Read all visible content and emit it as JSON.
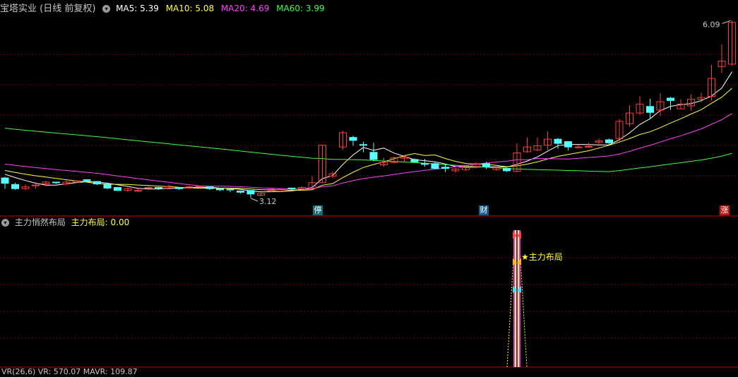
{
  "main_panel": {
    "title": "宝塔实业 (日线 前复权)",
    "indicators": [
      {
        "label": "MA5: 5.39",
        "color": "#ffffff"
      },
      {
        "label": "MA10: 5.08",
        "color": "#ffff40"
      },
      {
        "label": "MA20: 4.69",
        "color": "#ff40ff"
      },
      {
        "label": "MA60: 3.99",
        "color": "#40ff40"
      }
    ],
    "high_label": "6.09",
    "low_label": "3.12",
    "event_markers": [
      "停",
      "财",
      "涨"
    ]
  },
  "sub_panel": {
    "title": "主力悄然布局",
    "value_label": "主力布局: 0.00",
    "signal_label": "主力布局"
  },
  "bottom_strip": {
    "label": "VR(26,6)  VR: 570.07  MAVR: 109.87"
  },
  "colors": {
    "up": "#ff3c3c",
    "down": "#54ffff",
    "grid": "#7a0000",
    "divider": "#c80000",
    "ma5": "#ffffff",
    "ma10": "#ffff40",
    "ma20": "#ff40ff",
    "ma60": "#40ff40"
  },
  "chart_data": {
    "type": "candlestick",
    "ohlc": [
      [
        3.45,
        3.36,
        3.47,
        3.27
      ],
      [
        3.34,
        3.27,
        3.37,
        3.25
      ],
      [
        3.27,
        3.3,
        3.34,
        3.25
      ],
      [
        3.33,
        3.33,
        3.35,
        3.27
      ],
      [
        3.35,
        3.38,
        3.4,
        3.31
      ],
      [
        3.38,
        3.37,
        3.38,
        3.35
      ],
      [
        3.35,
        3.38,
        3.42,
        3.33
      ],
      [
        3.38,
        3.4,
        3.41,
        3.37
      ],
      [
        3.42,
        3.4,
        3.43,
        3.38
      ],
      [
        3.39,
        3.35,
        3.4,
        3.33
      ],
      [
        3.34,
        3.28,
        3.37,
        3.26
      ],
      [
        3.29,
        3.24,
        3.3,
        3.23
      ],
      [
        3.24,
        3.27,
        3.29,
        3.22
      ],
      [
        3.23,
        3.24,
        3.27,
        3.21
      ],
      [
        3.29,
        3.29,
        3.32,
        3.27
      ],
      [
        3.29,
        3.28,
        3.3,
        3.25
      ],
      [
        3.27,
        3.31,
        3.34,
        3.26
      ],
      [
        3.29,
        3.27,
        3.29,
        3.25
      ],
      [
        3.28,
        3.3,
        3.32,
        3.27
      ],
      [
        3.3,
        3.31,
        3.32,
        3.29
      ],
      [
        3.3,
        3.27,
        3.3,
        3.25
      ],
      [
        3.27,
        3.25,
        3.28,
        3.23
      ],
      [
        3.26,
        3.25,
        3.26,
        3.21
      ],
      [
        3.23,
        3.21,
        3.24,
        3.19
      ],
      [
        3.24,
        3.18,
        3.24,
        3.12
      ],
      [
        3.16,
        3.19,
        3.2,
        3.14
      ],
      [
        3.23,
        3.26,
        3.27,
        3.21
      ],
      [
        3.26,
        3.26,
        3.28,
        3.24
      ],
      [
        3.28,
        3.27,
        3.28,
        3.25
      ],
      [
        3.27,
        3.29,
        3.31,
        3.24
      ],
      [
        3.28,
        3.37,
        3.48,
        3.28
      ],
      [
        3.37,
        4.0,
        4.0,
        3.37
      ],
      [
        3.48,
        3.52,
        3.56,
        3.45
      ],
      [
        3.97,
        4.21,
        4.24,
        3.92
      ],
      [
        4.13,
        4.08,
        4.16,
        3.99
      ],
      [
        4.01,
        4.0,
        4.06,
        3.88
      ],
      [
        3.88,
        3.76,
        4.04,
        3.73
      ],
      [
        3.67,
        3.71,
        3.79,
        3.64
      ],
      [
        3.71,
        3.79,
        3.81,
        3.69
      ],
      [
        3.78,
        3.8,
        3.83,
        3.71
      ],
      [
        3.76,
        3.72,
        3.78,
        3.71
      ],
      [
        3.69,
        3.68,
        3.77,
        3.64
      ],
      [
        3.69,
        3.61,
        3.72,
        3.6
      ],
      [
        3.63,
        3.61,
        3.67,
        3.55
      ],
      [
        3.57,
        3.6,
        3.62,
        3.54
      ],
      [
        3.59,
        3.64,
        3.67,
        3.57
      ],
      [
        3.64,
        3.69,
        3.71,
        3.61
      ],
      [
        3.69,
        3.64,
        3.72,
        3.6
      ],
      [
        3.59,
        3.62,
        3.64,
        3.57
      ],
      [
        3.61,
        3.57,
        3.62,
        3.55
      ],
      [
        3.56,
        3.87,
        4.03,
        3.55
      ],
      [
        3.89,
        3.97,
        4.13,
        3.87
      ],
      [
        3.92,
        3.99,
        4.13,
        3.9
      ],
      [
        4.0,
        4.1,
        4.23,
        3.92
      ],
      [
        4.1,
        4.03,
        4.12,
        3.94
      ],
      [
        4.06,
        3.97,
        4.07,
        3.91
      ],
      [
        3.97,
        3.97,
        4.01,
        3.96
      ],
      [
        3.98,
        3.98,
        4.04,
        3.96
      ],
      [
        4.05,
        4.07,
        4.11,
        3.98
      ],
      [
        4.09,
        4.04,
        4.11,
        4.02
      ],
      [
        4.11,
        4.4,
        4.44,
        4.07
      ],
      [
        4.36,
        4.54,
        4.67,
        4.31
      ],
      [
        4.54,
        4.69,
        4.82,
        4.51
      ],
      [
        4.65,
        4.55,
        4.78,
        4.45
      ],
      [
        4.59,
        4.73,
        4.87,
        4.49
      ],
      [
        4.79,
        4.75,
        4.81,
        4.59
      ],
      [
        4.61,
        4.69,
        4.77,
        4.61
      ],
      [
        4.66,
        4.77,
        4.85,
        4.58
      ],
      [
        4.77,
        4.8,
        4.88,
        4.72
      ],
      [
        4.82,
        5.12,
        5.35,
        4.75
      ],
      [
        5.32,
        5.41,
        5.69,
        5.21
      ],
      [
        5.36,
        6.06,
        6.09,
        5.33
      ]
    ],
    "ma_series": [
      "MA5",
      "MA10",
      "MA20",
      "MA60"
    ],
    "sub_series": {
      "name": "主力布局",
      "values": [
        0,
        0,
        0,
        0,
        0,
        0,
        0,
        0,
        0,
        0,
        0,
        0,
        0,
        0,
        0,
        0,
        0,
        0,
        0,
        0,
        0,
        0,
        0,
        0,
        0,
        0,
        0,
        0,
        0,
        0,
        0,
        0,
        0,
        0,
        0,
        0,
        0,
        0,
        0,
        0,
        0,
        0,
        0,
        0,
        0,
        0,
        0,
        0,
        0,
        0,
        1,
        0,
        0,
        0,
        0,
        0,
        0,
        0,
        0,
        0,
        0,
        0,
        0,
        0,
        0,
        0,
        0,
        0,
        0,
        0,
        0,
        0
      ]
    },
    "ylim": [
      3.0,
      6.2
    ]
  }
}
